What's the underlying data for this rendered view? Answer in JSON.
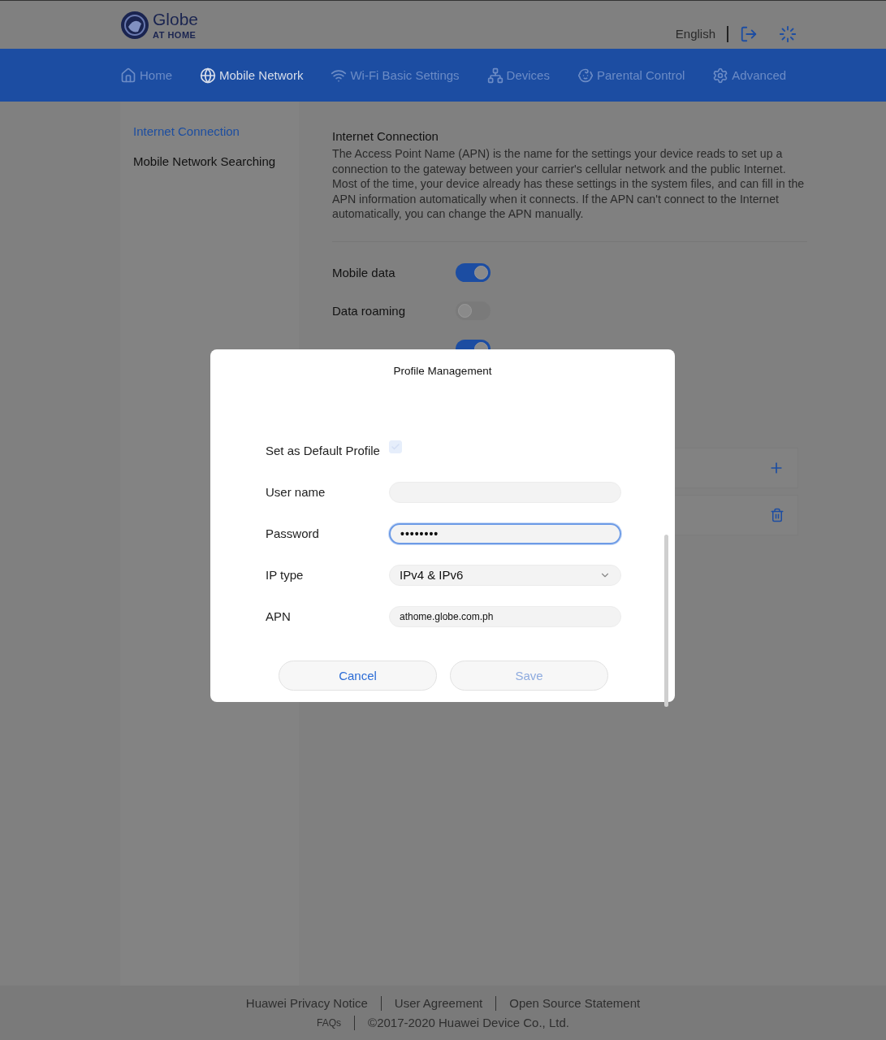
{
  "header": {
    "logo_name": "Globe",
    "logo_tagline": "AT HOME",
    "language": "English"
  },
  "nav": [
    {
      "label": "Home",
      "selected": false
    },
    {
      "label": "Mobile Network",
      "selected": true
    },
    {
      "label": "Wi-Fi Basic Settings",
      "selected": false
    },
    {
      "label": "Devices",
      "selected": false
    },
    {
      "label": "Parental Control",
      "selected": false
    },
    {
      "label": "Advanced",
      "selected": false
    }
  ],
  "sidebar": {
    "items": [
      {
        "label": "Internet Connection",
        "selected": true
      },
      {
        "label": "Mobile Network Searching",
        "selected": false
      }
    ]
  },
  "section": {
    "title": "Internet Connection",
    "description": "The Access Point Name (APN) is the name for the settings your device reads to set up a connection to the gateway between your carrier's cellular network and the public Internet. Most of the time, your device already has these settings in the system files, and can fill in the APN information automatically when it connects. If the APN can't connect to the Internet automatically, you can change the APN manually."
  },
  "switches": [
    {
      "label": "Mobile data",
      "on": true
    },
    {
      "label": "Data roaming",
      "on": false
    },
    {
      "on": true
    }
  ],
  "dialog": {
    "title": "Profile Management",
    "default_profile": {
      "label": "Set as Default Profile",
      "checked": true,
      "disabled": true
    },
    "fields": [
      {
        "kind": "text",
        "label": "User name",
        "focused": false
      },
      {
        "kind": "text",
        "label": "Password",
        "value": "••••••••",
        "focused": true
      },
      {
        "kind": "select",
        "label": "IP type",
        "value": "IPv4 & IPv6",
        "focused": false
      },
      {
        "kind": "text",
        "label": "APN",
        "value": "athome.globe.com.ph",
        "focused": false
      }
    ],
    "buttons": [
      {
        "label": "Cancel",
        "disabled": false
      },
      {
        "label": "Save",
        "disabled": true
      }
    ]
  },
  "footer": {
    "rows": [
      [
        "Huawei Privacy Notice",
        "User Agreement",
        "Open Source Statement"
      ],
      [
        "FAQs",
        "©2017-2020 Huawei Device Co., Ltd."
      ]
    ]
  }
}
